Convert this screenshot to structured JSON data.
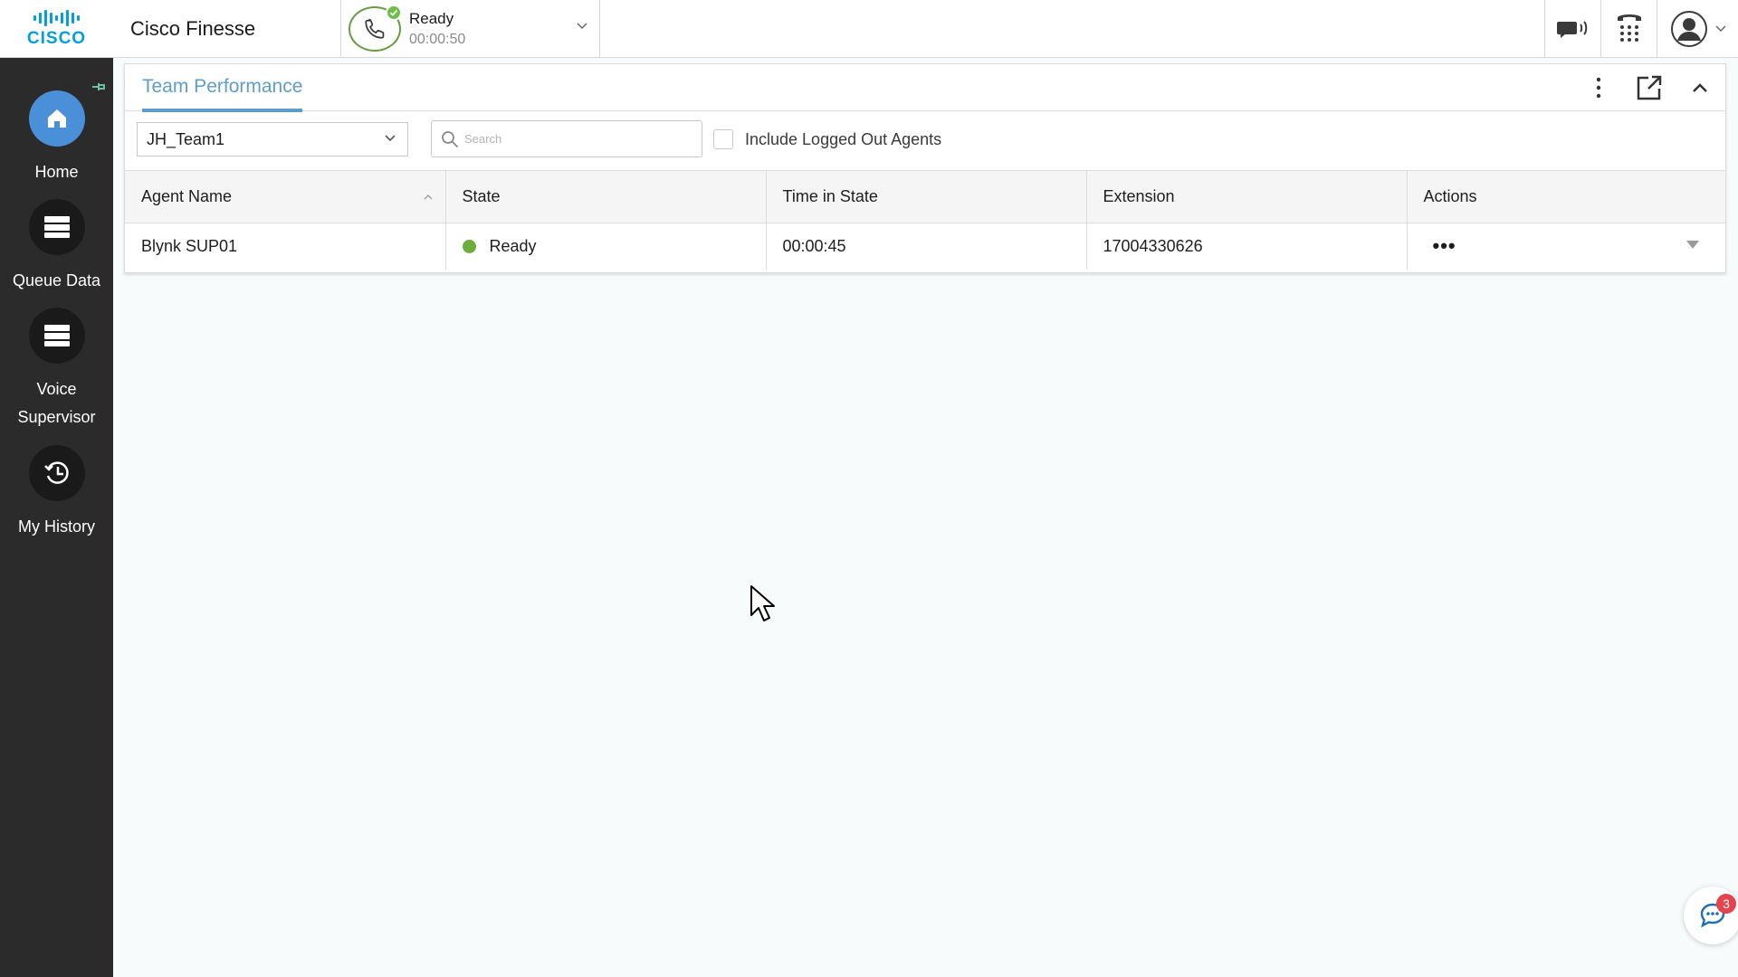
{
  "header": {
    "brand": "CISCO",
    "app_title": "Cisco Finesse",
    "agent_state": {
      "label": "Ready",
      "timer": "00:00:50",
      "status_color": "#6cc04a"
    },
    "icons": [
      "chat-icon",
      "dialpad-icon",
      "user-avatar-icon"
    ]
  },
  "sidebar": {
    "items": [
      {
        "label": "Home",
        "icon": "home-icon",
        "active": true
      },
      {
        "label": "Queue Data",
        "icon": "queue-data-icon",
        "active": false
      },
      {
        "label": "Voice Supervisor",
        "icon": "voice-supervisor-icon",
        "active": false
      },
      {
        "label": "My History",
        "icon": "history-icon",
        "active": false
      }
    ]
  },
  "gadget": {
    "tab": "Team Performance",
    "team_select_value": "JH_Team1",
    "search_placeholder": "Search",
    "include_logged_out_label": "Include Logged Out Agents",
    "include_logged_out_checked": false,
    "columns": [
      "Agent Name",
      "State",
      "Time in State",
      "Extension",
      "Actions"
    ],
    "rows": [
      {
        "agent_name": "Blynk SUP01",
        "state": "Ready",
        "state_color": "#6cae3e",
        "time_in_state": "00:00:45",
        "extension": "17004330626",
        "actions": "•••"
      }
    ]
  },
  "chat_widget": {
    "badge_count": "3"
  },
  "colors": {
    "accent": "#5f9dc9",
    "sidebar_bg": "#2b2b2b",
    "active_nav": "#4a90d9"
  }
}
